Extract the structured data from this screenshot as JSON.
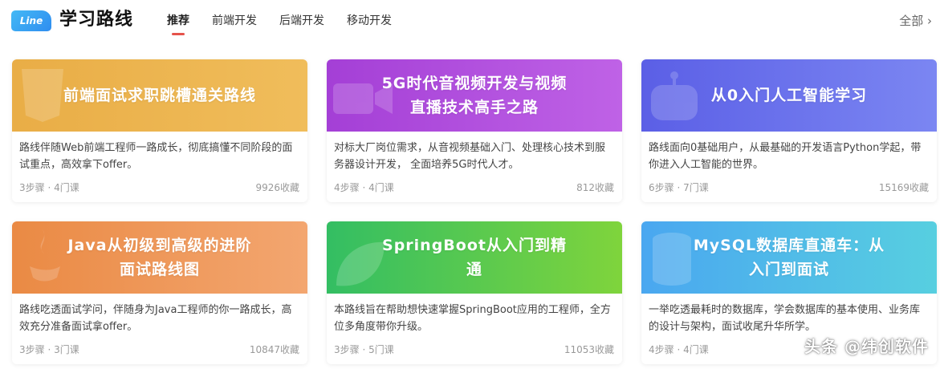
{
  "header": {
    "logo_badge": "Line",
    "title": "学习路线",
    "tabs": [
      {
        "label": "推荐",
        "active": true
      },
      {
        "label": "前端开发",
        "active": false
      },
      {
        "label": "后端开发",
        "active": false
      },
      {
        "label": "移动开发",
        "active": false
      }
    ],
    "view_all": "全部 ›",
    "accent_color": "#e5534b"
  },
  "cards": [
    {
      "title": "前端面试求职跳槽通关路线",
      "description": "路线伴随Web前端工程师一路成长，彻底搞懂不同阶段的面试重点，高效拿下offer。",
      "steps": "3步骤 · 4门课",
      "favorites": "9926收藏",
      "banner_icon": "html5-icon",
      "color": "#e9ad46"
    },
    {
      "title": "5G时代音视频开发与视频直播技术高手之路",
      "description": "对标大厂岗位需求，从音视频基础入门、处理核心技术到服务器设计开发， 全面培养5G时代人才。",
      "steps": "4步骤 · 4门课",
      "favorites": "812收藏",
      "banner_icon": "video-camera-icon",
      "color": "#a43fd6"
    },
    {
      "title": "从0入门人工智能学习",
      "description": "路线面向0基础用户，从最基础的开发语言Python学起，带你进入人工智能的世界。",
      "steps": "6步骤 · 7门课",
      "favorites": "15169收藏",
      "banner_icon": "robot-icon",
      "color": "#5b5fe6"
    },
    {
      "title": "Java从初级到高级的进阶面试路线图",
      "description": "路线吃透面试学问，伴随身为Java工程师的你一路成长，高效充分准备面试拿offer。",
      "steps": "3步骤 · 3门课",
      "favorites": "10847收藏",
      "banner_icon": "java-icon",
      "color": "#ea8a44"
    },
    {
      "title": "SpringBoot从入门到精通",
      "description": "本路线旨在帮助想快速掌握SpringBoot应用的工程师，全方位多角度带你升级。",
      "steps": "3步骤 · 5门课",
      "favorites": "11053收藏",
      "banner_icon": "spring-leaf-icon",
      "color": "#33be63"
    },
    {
      "title": "MySQL数据库直通车：从入门到面试",
      "description": "一举吃透最耗时的数据库，学会数据库的基本使用、业务库的设计与架构，面试收尾升华所学。",
      "steps": "4步骤 · 4门课",
      "favorites": "",
      "banner_icon": "database-icon",
      "color": "#4aa7f0"
    }
  ],
  "watermark": "头条 @纬创软件"
}
